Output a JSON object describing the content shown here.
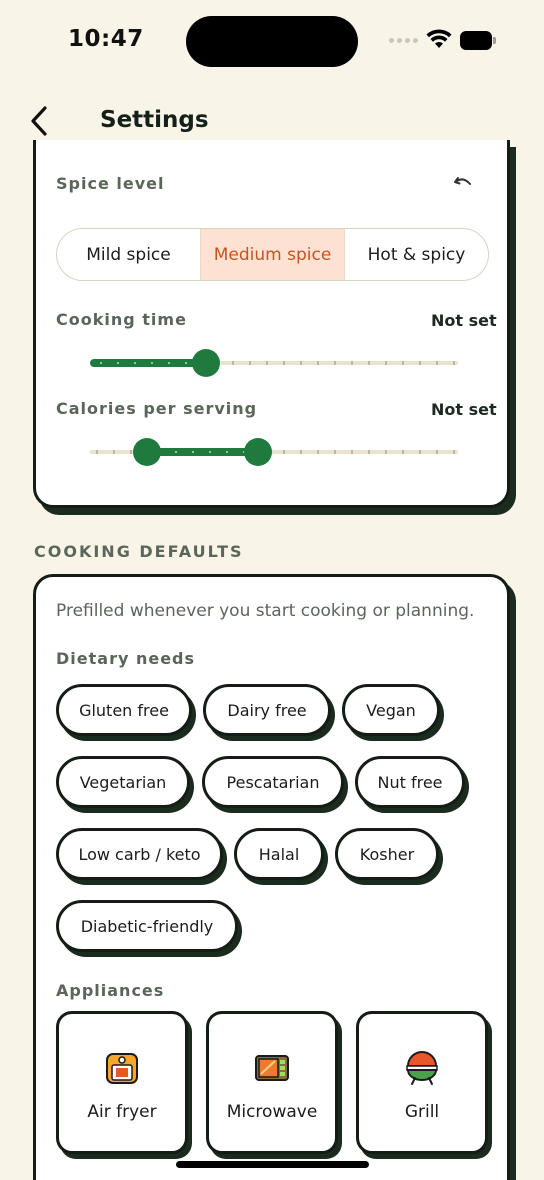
{
  "status": {
    "time": "10:47"
  },
  "nav": {
    "title": "Settings"
  },
  "spice": {
    "label": "Spice level",
    "options": [
      "Mild spice",
      "Medium spice",
      "Hot & spicy"
    ],
    "selected": "Medium spice"
  },
  "cooking_time": {
    "label": "Cooking time",
    "value": "Not set"
  },
  "calories": {
    "label": "Calories per serving",
    "value": "Not set"
  },
  "cooking_defaults": {
    "section_title": "COOKING DEFAULTS",
    "helper": "Prefilled whenever you start cooking or planning.",
    "dietary_label": "Dietary needs",
    "dietary": [
      "Gluten free",
      "Dairy free",
      "Vegan",
      "Vegetarian",
      "Pescatarian",
      "Nut free",
      "Low carb / keto",
      "Halal",
      "Kosher",
      "Diabetic-friendly"
    ],
    "appliances_label": "Appliances",
    "appliances": [
      {
        "name": "Air fryer",
        "icon": "air-fryer-icon"
      },
      {
        "name": "Microwave",
        "icon": "microwave-icon"
      },
      {
        "name": "Grill",
        "icon": "grill-icon"
      }
    ]
  },
  "colors": {
    "background": "#f9f4e8",
    "accent_green": "#1f7a3e",
    "selected_orange": "#c9531f",
    "selected_bg": "#fde2d3"
  }
}
